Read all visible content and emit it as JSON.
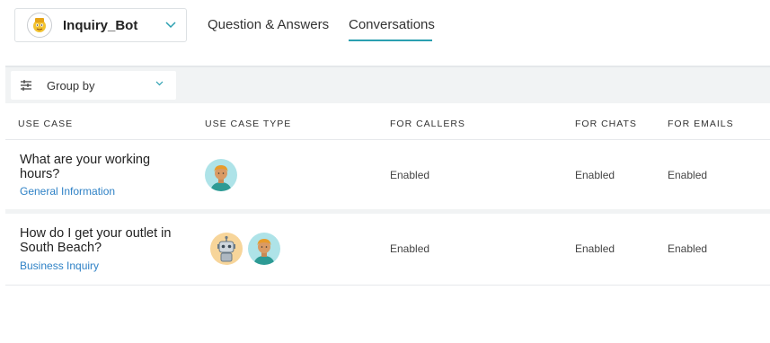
{
  "bot": {
    "name": "Inquiry_Bot",
    "avatar": "bot-mascot-icon"
  },
  "tabs": [
    {
      "label": "Question & Answers",
      "active": false
    },
    {
      "label": "Conversations",
      "active": true
    }
  ],
  "toolbar": {
    "group_by_label": "Group by",
    "group_by_icon": "sliders-icon"
  },
  "table": {
    "headers": [
      "USE CASE",
      "USE CASE TYPE",
      "FOR CALLERS",
      "FOR CHATS",
      "FOR EMAILS"
    ],
    "rows": [
      {
        "title": "What are your working hours?",
        "category": "General Information",
        "types": [
          "human-agent-icon"
        ],
        "callers": "Enabled",
        "chats": "Enabled",
        "emails": "Enabled"
      },
      {
        "title": "How do I get your outlet in South Beach?",
        "category": "Business Inquiry",
        "types": [
          "robot-icon",
          "human-agent-icon"
        ],
        "callers": "Enabled",
        "chats": "Enabled",
        "emails": "Enabled"
      }
    ]
  },
  "colors": {
    "accent": "#2a9fb0",
    "link": "#2f82c6",
    "agent_bg": "#aee3e8",
    "robot_bg": "#f7d59a"
  }
}
